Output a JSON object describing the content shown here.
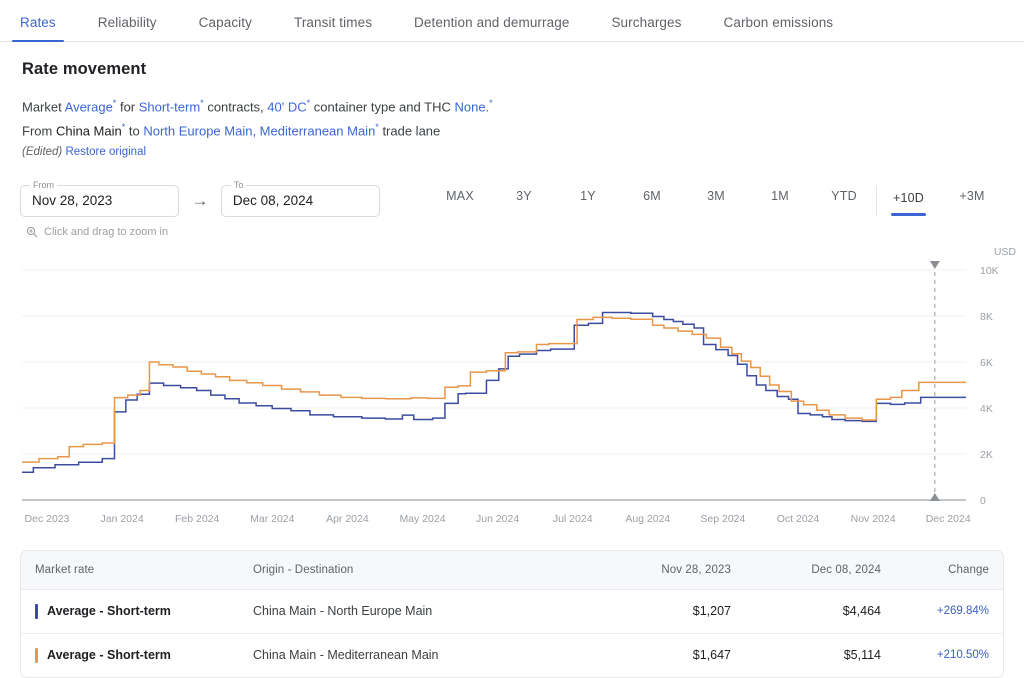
{
  "colors": {
    "accent": "#3a66d4",
    "series_blue": "#3b4ca0",
    "series_orange": "#e8964a",
    "change_text": "#3a5ec4",
    "grid": "#f0f1f3",
    "axis": "#9aa0a6"
  },
  "tabs": [
    {
      "label": "Rates",
      "active": true
    },
    {
      "label": "Reliability",
      "active": false
    },
    {
      "label": "Capacity",
      "active": false
    },
    {
      "label": "Transit times",
      "active": false
    },
    {
      "label": "Detention and demurrage",
      "active": false
    },
    {
      "label": "Surcharges",
      "active": false
    },
    {
      "label": "Carbon emissions",
      "active": false
    }
  ],
  "header": {
    "title": "Rate movement",
    "line1": {
      "w1": "Market",
      "market": "Average",
      "w2": "for",
      "contract": "Short-term",
      "w3": "contracts,",
      "container": "40' DC",
      "w4": "container type and THC",
      "thc": "None.",
      "sup": "*"
    },
    "line2": {
      "w1": "From",
      "origin": "China Main",
      "w2": "to",
      "destination": "North Europe Main, Mediterranean Main",
      "w3": "trade lane"
    },
    "edited": "(Edited)",
    "restore": "Restore original"
  },
  "toolbar": {
    "from_label": "From",
    "from_value": "Nov 28, 2023",
    "arrow_icon": "arrow-right-icon",
    "to_label": "To",
    "to_value": "Dec 08, 2024",
    "ranges": [
      {
        "label": "MAX",
        "active": false,
        "sep": false
      },
      {
        "label": "3Y",
        "active": false,
        "sep": false
      },
      {
        "label": "1Y",
        "active": false,
        "sep": false
      },
      {
        "label": "6M",
        "active": false,
        "sep": false
      },
      {
        "label": "3M",
        "active": false,
        "sep": false
      },
      {
        "label": "1M",
        "active": false,
        "sep": false
      },
      {
        "label": "YTD",
        "active": false,
        "sep": false
      },
      {
        "label": "+10D",
        "active": true,
        "sep": true
      },
      {
        "label": "+3M",
        "active": false,
        "sep": false
      }
    ]
  },
  "chart_hint": {
    "icon": "zoom-in-icon",
    "text": "Click and drag to zoom in"
  },
  "chart_data": {
    "type": "line",
    "title": "Rate movement",
    "xlabel": "",
    "ylabel": "USD",
    "y_unit_label": "USD",
    "ylim": [
      0,
      10000
    ],
    "yticks": [
      0,
      2000,
      4000,
      6000,
      8000,
      10000
    ],
    "ytick_labels": [
      "0",
      "2K",
      "4K",
      "6K",
      "8K",
      "10K"
    ],
    "grid": true,
    "legend": "below-in-table",
    "x_tick_labels": [
      "Dec 2023",
      "Jan 2024",
      "Feb 2024",
      "Mar 2024",
      "Apr 2024",
      "May 2024",
      "Jun 2024",
      "Jul 2024",
      "Aug 2024",
      "Sep 2024",
      "Oct 2024",
      "Nov 2024",
      "Dec 2024"
    ],
    "x_range": [
      "Nov 28, 2023",
      "Dec 08, 2024"
    ],
    "marker": {
      "type": "vertical-dashed-cursor",
      "x_label": "Dec 2024",
      "x_frac": 0.967
    },
    "series": [
      {
        "name": "Average - Short-term",
        "route": "China Main - North Europe Main",
        "color": "#3b4ca0",
        "step": true,
        "points": [
          [
            0.0,
            1207
          ],
          [
            0.012,
            1207
          ],
          [
            0.012,
            1400
          ],
          [
            0.035,
            1400
          ],
          [
            0.035,
            1530
          ],
          [
            0.06,
            1530
          ],
          [
            0.06,
            1640
          ],
          [
            0.085,
            1640
          ],
          [
            0.085,
            1800
          ],
          [
            0.098,
            1800
          ],
          [
            0.098,
            3830
          ],
          [
            0.11,
            3830
          ],
          [
            0.11,
            4350
          ],
          [
            0.122,
            4350
          ],
          [
            0.122,
            4600
          ],
          [
            0.135,
            4600
          ],
          [
            0.135,
            5080
          ],
          [
            0.15,
            5080
          ],
          [
            0.15,
            4980
          ],
          [
            0.168,
            4980
          ],
          [
            0.168,
            4880
          ],
          [
            0.185,
            4880
          ],
          [
            0.185,
            4760
          ],
          [
            0.2,
            4760
          ],
          [
            0.2,
            4560
          ],
          [
            0.215,
            4560
          ],
          [
            0.215,
            4400
          ],
          [
            0.23,
            4400
          ],
          [
            0.23,
            4220
          ],
          [
            0.248,
            4220
          ],
          [
            0.248,
            4100
          ],
          [
            0.265,
            4100
          ],
          [
            0.265,
            3980
          ],
          [
            0.285,
            3980
          ],
          [
            0.285,
            3880
          ],
          [
            0.305,
            3880
          ],
          [
            0.305,
            3700
          ],
          [
            0.33,
            3700
          ],
          [
            0.33,
            3620
          ],
          [
            0.36,
            3620
          ],
          [
            0.36,
            3560
          ],
          [
            0.385,
            3560
          ],
          [
            0.385,
            3520
          ],
          [
            0.403,
            3520
          ],
          [
            0.403,
            3690
          ],
          [
            0.415,
            3690
          ],
          [
            0.415,
            3500
          ],
          [
            0.435,
            3500
          ],
          [
            0.435,
            3560
          ],
          [
            0.448,
            3560
          ],
          [
            0.448,
            4200
          ],
          [
            0.462,
            4200
          ],
          [
            0.462,
            4620
          ],
          [
            0.47,
            4620
          ],
          [
            0.47,
            4640
          ],
          [
            0.492,
            4640
          ],
          [
            0.492,
            5200
          ],
          [
            0.505,
            5200
          ],
          [
            0.505,
            5700
          ],
          [
            0.515,
            5700
          ],
          [
            0.515,
            6250
          ],
          [
            0.527,
            6250
          ],
          [
            0.527,
            6340
          ],
          [
            0.545,
            6340
          ],
          [
            0.545,
            6500
          ],
          [
            0.56,
            6500
          ],
          [
            0.56,
            6560
          ],
          [
            0.585,
            6560
          ],
          [
            0.585,
            7600
          ],
          [
            0.6,
            7600
          ],
          [
            0.6,
            7680
          ],
          [
            0.615,
            7680
          ],
          [
            0.615,
            8150
          ],
          [
            0.645,
            8150
          ],
          [
            0.645,
            8120
          ],
          [
            0.668,
            8120
          ],
          [
            0.668,
            7980
          ],
          [
            0.68,
            7980
          ],
          [
            0.68,
            7850
          ],
          [
            0.69,
            7850
          ],
          [
            0.69,
            7760
          ],
          [
            0.7,
            7760
          ],
          [
            0.7,
            7640
          ],
          [
            0.712,
            7640
          ],
          [
            0.712,
            7480
          ],
          [
            0.722,
            7480
          ],
          [
            0.722,
            6760
          ],
          [
            0.735,
            6760
          ],
          [
            0.735,
            6540
          ],
          [
            0.748,
            6540
          ],
          [
            0.748,
            6280
          ],
          [
            0.758,
            6280
          ],
          [
            0.758,
            5900
          ],
          [
            0.768,
            5900
          ],
          [
            0.768,
            5400
          ],
          [
            0.778,
            5400
          ],
          [
            0.778,
            5000
          ],
          [
            0.788,
            5000
          ],
          [
            0.788,
            4760
          ],
          [
            0.8,
            4760
          ],
          [
            0.8,
            4500
          ],
          [
            0.812,
            4500
          ],
          [
            0.812,
            4380
          ],
          [
            0.822,
            4380
          ],
          [
            0.822,
            3760
          ],
          [
            0.835,
            3760
          ],
          [
            0.835,
            3700
          ],
          [
            0.848,
            3700
          ],
          [
            0.848,
            3620
          ],
          [
            0.858,
            3620
          ],
          [
            0.858,
            3500
          ],
          [
            0.872,
            3500
          ],
          [
            0.872,
            3450
          ],
          [
            0.89,
            3450
          ],
          [
            0.89,
            3420
          ],
          [
            0.905,
            3420
          ],
          [
            0.905,
            4200
          ],
          [
            0.92,
            4200
          ],
          [
            0.92,
            4160
          ],
          [
            0.935,
            4160
          ],
          [
            0.935,
            4220
          ],
          [
            0.952,
            4220
          ],
          [
            0.952,
            4464
          ],
          [
            1.0,
            4464
          ]
        ]
      },
      {
        "name": "Average - Short-term",
        "route": "China Main - Mediterranean Main",
        "color": "#e8964a",
        "step": true,
        "points": [
          [
            0.0,
            1647
          ],
          [
            0.018,
            1647
          ],
          [
            0.018,
            1800
          ],
          [
            0.038,
            1800
          ],
          [
            0.038,
            1880
          ],
          [
            0.05,
            1880
          ],
          [
            0.05,
            2320
          ],
          [
            0.065,
            2320
          ],
          [
            0.065,
            2420
          ],
          [
            0.085,
            2420
          ],
          [
            0.085,
            2480
          ],
          [
            0.098,
            2480
          ],
          [
            0.098,
            4450
          ],
          [
            0.112,
            4450
          ],
          [
            0.112,
            4560
          ],
          [
            0.125,
            4560
          ],
          [
            0.125,
            4760
          ],
          [
            0.135,
            4760
          ],
          [
            0.135,
            6000
          ],
          [
            0.145,
            6000
          ],
          [
            0.145,
            5880
          ],
          [
            0.16,
            5880
          ],
          [
            0.16,
            5780
          ],
          [
            0.175,
            5780
          ],
          [
            0.175,
            5600
          ],
          [
            0.19,
            5600
          ],
          [
            0.19,
            5480
          ],
          [
            0.205,
            5480
          ],
          [
            0.205,
            5360
          ],
          [
            0.22,
            5360
          ],
          [
            0.22,
            5200
          ],
          [
            0.238,
            5200
          ],
          [
            0.238,
            5100
          ],
          [
            0.255,
            5100
          ],
          [
            0.255,
            4980
          ],
          [
            0.275,
            4980
          ],
          [
            0.275,
            4820
          ],
          [
            0.295,
            4820
          ],
          [
            0.295,
            4700
          ],
          [
            0.315,
            4700
          ],
          [
            0.315,
            4560
          ],
          [
            0.338,
            4560
          ],
          [
            0.338,
            4460
          ],
          [
            0.36,
            4460
          ],
          [
            0.36,
            4420
          ],
          [
            0.385,
            4420
          ],
          [
            0.385,
            4400
          ],
          [
            0.412,
            4400
          ],
          [
            0.412,
            4440
          ],
          [
            0.43,
            4440
          ],
          [
            0.43,
            4420
          ],
          [
            0.448,
            4420
          ],
          [
            0.448,
            4900
          ],
          [
            0.462,
            4900
          ],
          [
            0.462,
            4960
          ],
          [
            0.475,
            4960
          ],
          [
            0.475,
            5560
          ],
          [
            0.492,
            5560
          ],
          [
            0.492,
            5620
          ],
          [
            0.512,
            5620
          ],
          [
            0.512,
            6400
          ],
          [
            0.525,
            6400
          ],
          [
            0.525,
            6440
          ],
          [
            0.545,
            6440
          ],
          [
            0.545,
            6760
          ],
          [
            0.558,
            6760
          ],
          [
            0.558,
            6800
          ],
          [
            0.588,
            6800
          ],
          [
            0.588,
            7850
          ],
          [
            0.605,
            7850
          ],
          [
            0.605,
            7940
          ],
          [
            0.625,
            7940
          ],
          [
            0.625,
            7900
          ],
          [
            0.645,
            7900
          ],
          [
            0.645,
            7860
          ],
          [
            0.668,
            7860
          ],
          [
            0.668,
            7600
          ],
          [
            0.68,
            7600
          ],
          [
            0.68,
            7480
          ],
          [
            0.695,
            7480
          ],
          [
            0.695,
            7340
          ],
          [
            0.71,
            7340
          ],
          [
            0.71,
            7200
          ],
          [
            0.725,
            7200
          ],
          [
            0.725,
            7040
          ],
          [
            0.74,
            7040
          ],
          [
            0.74,
            6640
          ],
          [
            0.752,
            6640
          ],
          [
            0.752,
            6360
          ],
          [
            0.762,
            6360
          ],
          [
            0.762,
            6040
          ],
          [
            0.772,
            6040
          ],
          [
            0.772,
            5760
          ],
          [
            0.782,
            5760
          ],
          [
            0.782,
            5380
          ],
          [
            0.792,
            5380
          ],
          [
            0.792,
            5000
          ],
          [
            0.802,
            5000
          ],
          [
            0.802,
            4720
          ],
          [
            0.815,
            4720
          ],
          [
            0.815,
            4300
          ],
          [
            0.828,
            4300
          ],
          [
            0.828,
            4140
          ],
          [
            0.842,
            4140
          ],
          [
            0.842,
            3900
          ],
          [
            0.855,
            3900
          ],
          [
            0.855,
            3700
          ],
          [
            0.872,
            3700
          ],
          [
            0.872,
            3560
          ],
          [
            0.89,
            3560
          ],
          [
            0.89,
            3480
          ],
          [
            0.905,
            3480
          ],
          [
            0.905,
            4380
          ],
          [
            0.92,
            4380
          ],
          [
            0.92,
            4460
          ],
          [
            0.932,
            4460
          ],
          [
            0.932,
            4760
          ],
          [
            0.95,
            4760
          ],
          [
            0.95,
            5114
          ],
          [
            1.0,
            5114
          ]
        ]
      }
    ]
  },
  "table": {
    "columns": [
      "Market rate",
      "Origin - Destination",
      "Nov 28, 2023",
      "Dec 08, 2024",
      "Change"
    ],
    "rows": [
      {
        "swatch_color": "#3b4ca0",
        "market_rate": "Average - Short-term",
        "route": "China Main - North Europe Main",
        "start_value": "$1,207",
        "end_value": "$4,464",
        "change": "+269.84%"
      },
      {
        "swatch_color": "#e8964a",
        "market_rate": "Average - Short-term",
        "route": "China Main - Mediterranean Main",
        "start_value": "$1,647",
        "end_value": "$5,114",
        "change": "+210.50%"
      }
    ]
  }
}
